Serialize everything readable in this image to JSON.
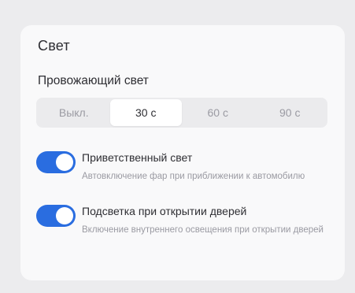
{
  "section": {
    "title": "Свет"
  },
  "follow_me_light": {
    "title": "Провожающий свет",
    "options": [
      "Выкл.",
      "30 с",
      "60 с",
      "90 с"
    ],
    "selected": "30 с"
  },
  "toggles": [
    {
      "label": "Приветственный свет",
      "description": "Автовключение фар при приближении к автомобилю",
      "enabled": true
    },
    {
      "label": "Подсветка при открытии дверей",
      "description": "Включение внутреннего освещения при открытии дверей",
      "enabled": true
    }
  ],
  "colors": {
    "accent": "#2a6de0",
    "background": "#ececee",
    "panel": "#f9f9fa"
  }
}
